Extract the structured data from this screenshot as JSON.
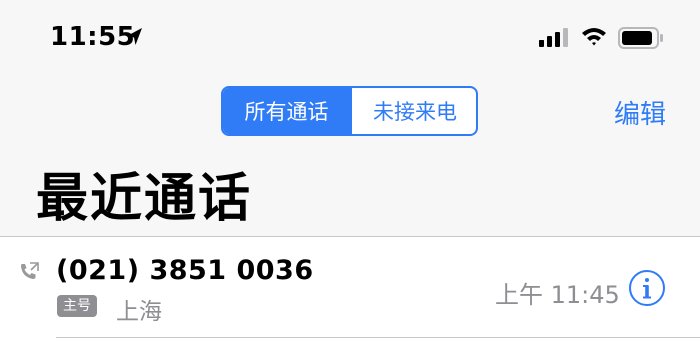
{
  "status_bar": {
    "time": "11:55",
    "icons": [
      "location-arrow-icon",
      "cellular-signal-icon",
      "wifi-icon",
      "battery-icon"
    ]
  },
  "segmented_control": {
    "options": [
      "所有通话",
      "未接来电"
    ],
    "selected": "所有通话"
  },
  "header": {
    "edit_label": "编辑",
    "title": "最近通话"
  },
  "calls": [
    {
      "number": "(021) 3851 0036",
      "badge": "主号",
      "location": "上海",
      "time": "上午 11:45",
      "type_icon": "outgoing-phone-icon"
    }
  ],
  "colors": {
    "accent": "#2f7cf6",
    "background": "#f7f7f8",
    "secondary_text": "#8e8e93"
  }
}
